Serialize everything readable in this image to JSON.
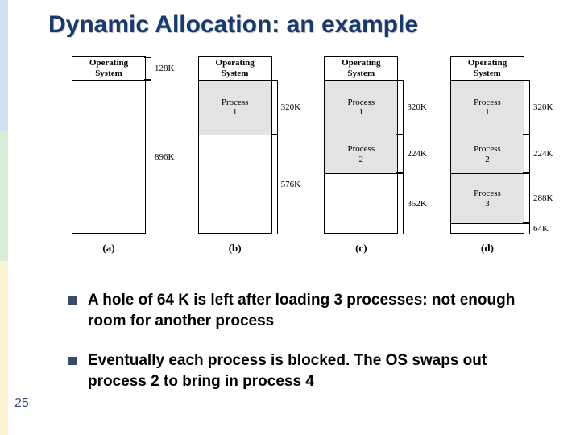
{
  "title": "Dynamic Allocation: an example",
  "page_number": "25",
  "bullets": [
    "A hole of 64 K is left after loading 3 processes: not enough room for another process",
    "Eventually each process is blocked. The OS swaps out process 2 to bring in process 4"
  ],
  "chart_data": [
    {
      "type": "table",
      "label": "(a)",
      "total_k": 1024,
      "segments": [
        {
          "name": "Operating System",
          "size_k": 128,
          "shaded": false,
          "brace": "128K"
        },
        {
          "name": "",
          "size_k": 896,
          "shaded": false,
          "brace": "896K"
        }
      ]
    },
    {
      "type": "table",
      "label": "(b)",
      "total_k": 1024,
      "segments": [
        {
          "name": "Operating System",
          "size_k": 128,
          "shaded": false,
          "brace": null
        },
        {
          "name": "Process 1",
          "size_k": 320,
          "shaded": true,
          "brace": "320K"
        },
        {
          "name": "",
          "size_k": 576,
          "shaded": false,
          "brace": "576K"
        }
      ]
    },
    {
      "type": "table",
      "label": "(c)",
      "total_k": 1024,
      "segments": [
        {
          "name": "Operating System",
          "size_k": 128,
          "shaded": false,
          "brace": null
        },
        {
          "name": "Process 1",
          "size_k": 320,
          "shaded": true,
          "brace": "320K"
        },
        {
          "name": "Process 2",
          "size_k": 224,
          "shaded": true,
          "brace": "224K"
        },
        {
          "name": "",
          "size_k": 352,
          "shaded": false,
          "brace": "352K"
        }
      ]
    },
    {
      "type": "table",
      "label": "(d)",
      "total_k": 1024,
      "segments": [
        {
          "name": "Operating System",
          "size_k": 128,
          "shaded": false,
          "brace": null
        },
        {
          "name": "Process 1",
          "size_k": 320,
          "shaded": true,
          "brace": "320K"
        },
        {
          "name": "Process 2",
          "size_k": 224,
          "shaded": true,
          "brace": "224K"
        },
        {
          "name": "Process 3",
          "size_k": 288,
          "shaded": true,
          "brace": "288K"
        },
        {
          "name": "",
          "size_k": 64,
          "shaded": false,
          "brace": "64K"
        }
      ]
    }
  ]
}
